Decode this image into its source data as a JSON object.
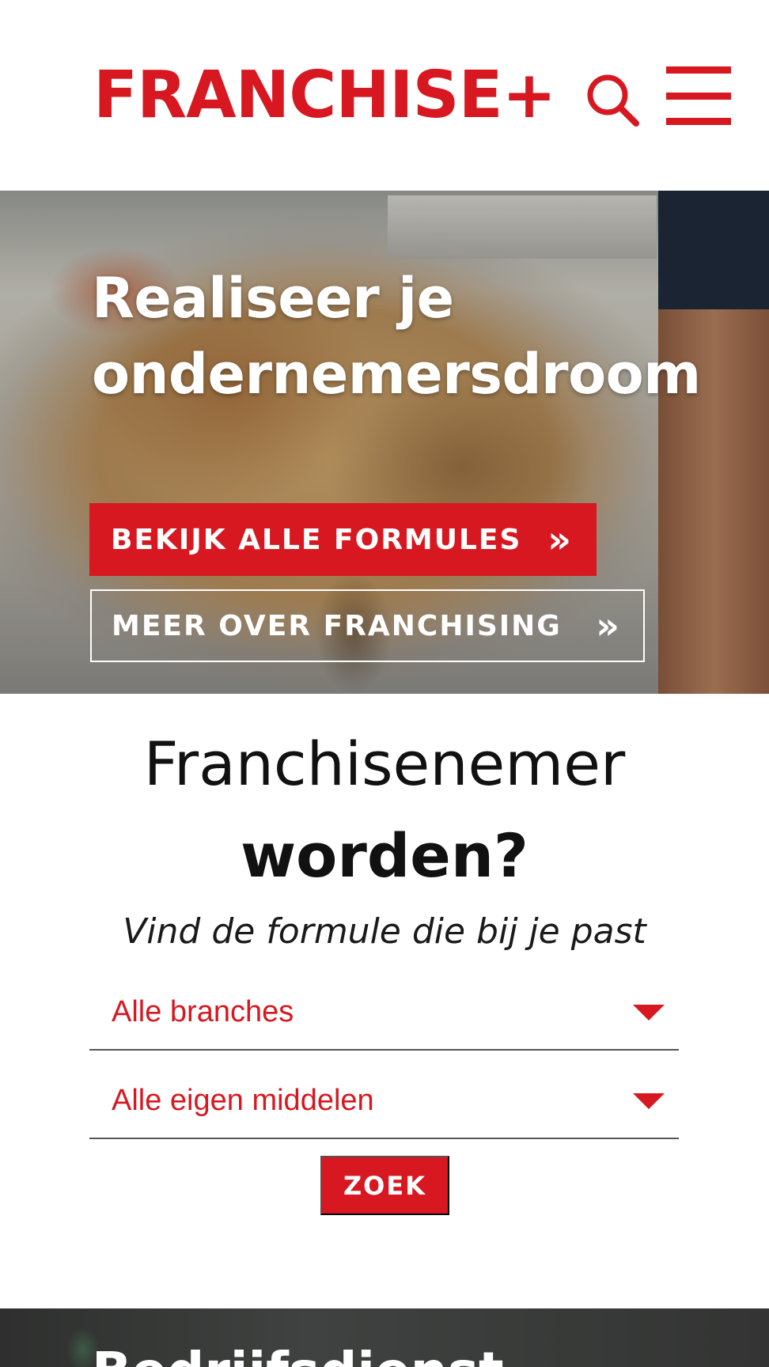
{
  "header": {
    "logo_text": "FRANCHISE+",
    "search_icon": "search-icon",
    "menu_icon": "hamburger-menu-icon",
    "brand_color": "#d71820"
  },
  "hero": {
    "title_line1": "Realiseer je",
    "title_line2": "ondernemersdroom",
    "primary_button": {
      "label": "BEKIJK ALLE FORMULES",
      "arrow": "»"
    },
    "secondary_button": {
      "label": "MEER OVER FRANCHISING",
      "arrow": "»"
    }
  },
  "search": {
    "title_line1": "Franchisenemer",
    "title_line2": "worden?",
    "subtitle": "Vind de formule die bij je past",
    "branch_select": {
      "value": "Alle branches",
      "icon": "caret-down-icon"
    },
    "funds_select": {
      "value": "Alle eigen middelen",
      "icon": "caret-down-icon"
    },
    "submit_label": "ZOEK"
  },
  "bottom_section": {
    "title": "Bedrijfsdienst..."
  }
}
